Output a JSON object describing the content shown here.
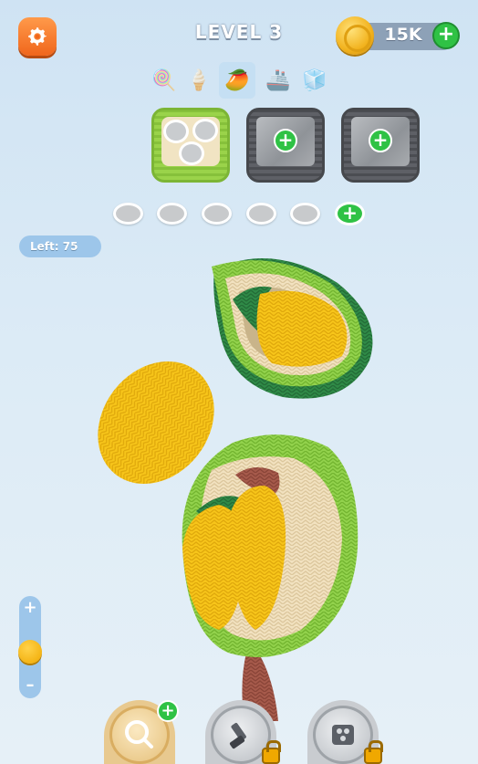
{
  "header": {
    "level_title": "LEVEL 3",
    "coins": "15K",
    "settings_icon": "gear-icon",
    "coin_icon": "coin-icon",
    "add_coins_icon": "plus-icon"
  },
  "levels": [
    {
      "icon": "lollipop-icon",
      "glyph": "🍭",
      "active": false
    },
    {
      "icon": "ice-cream-icon",
      "glyph": "🍦",
      "active": false
    },
    {
      "icon": "durian-icon",
      "glyph": "🥭",
      "active": true
    },
    {
      "icon": "boat-icon",
      "glyph": "🚢",
      "active": false
    },
    {
      "icon": "cube-icon",
      "glyph": "🧊",
      "active": false
    }
  ],
  "boxes": [
    {
      "type": "active",
      "color": "green",
      "holes": 3
    },
    {
      "type": "locked",
      "color": "gray",
      "action_icon": "plus-icon"
    },
    {
      "type": "locked",
      "color": "gray",
      "action_icon": "plus-icon"
    }
  ],
  "spool_slots": {
    "empty_count": 5,
    "add_icon": "plus-icon"
  },
  "remaining": {
    "text": "Left:  75",
    "value": 75
  },
  "zoom": {
    "plus": "+",
    "minus": "–",
    "level": 0.45
  },
  "tools": [
    {
      "name": "add-spool",
      "icon": "magnifier-plus-icon",
      "locked": false,
      "badge": "plus-icon"
    },
    {
      "name": "vacuum",
      "icon": "vacuum-icon",
      "locked": true
    },
    {
      "name": "box-tool",
      "icon": "box-icon",
      "locked": true
    }
  ],
  "colors": {
    "accent_orange": "#f0661c",
    "accent_green": "#2fc245",
    "yarn_yellow": "#f7c51a",
    "yarn_green": "#8fd04a",
    "yarn_cream": "#f2e2c0",
    "yarn_brown": "#a2584a",
    "background": "#d6e8f5"
  }
}
